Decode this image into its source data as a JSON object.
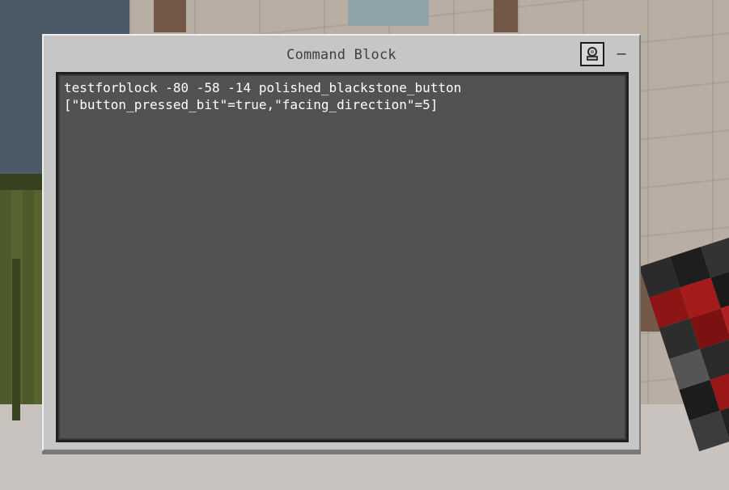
{
  "dialog": {
    "title": "Command Block",
    "minimize_label": "–",
    "settings_icon": "command-block-settings-icon"
  },
  "command_input": {
    "lines": [
      "testforblock -80 -58 -14 polished_blackstone_button",
      "[\"button_pressed_bit\"=true,\"facing_direction\"=5]"
    ]
  },
  "colors": {
    "dialog_bg": "#c6c6c6",
    "editor_bg": "#525252",
    "text": "#ffffff"
  }
}
